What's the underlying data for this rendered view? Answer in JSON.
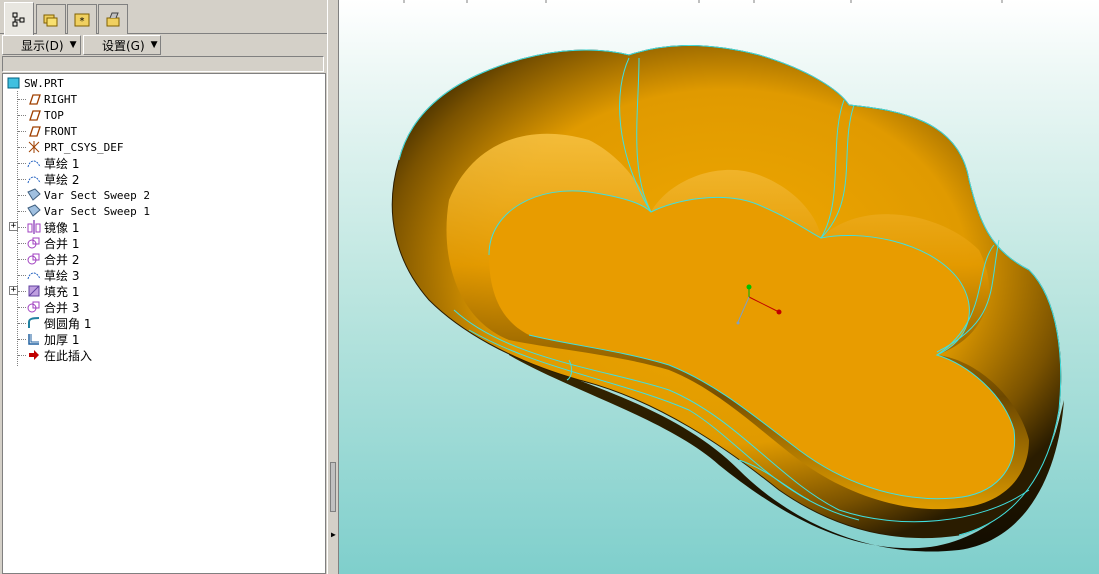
{
  "toolbar": {
    "show_label": "显示(D)",
    "settings_label": "设置(G)"
  },
  "tree": {
    "root": "SW.PRT",
    "items": [
      {
        "label": "RIGHT",
        "icon": "datum-plane-icon"
      },
      {
        "label": "TOP",
        "icon": "datum-plane-icon"
      },
      {
        "label": "FRONT",
        "icon": "datum-plane-icon"
      },
      {
        "label": "PRT_CSYS_DEF",
        "icon": "csys-icon"
      },
      {
        "label": "草绘 1",
        "icon": "sketch-icon"
      },
      {
        "label": "草绘 2",
        "icon": "sketch-icon"
      },
      {
        "label": "Var Sect Sweep 2",
        "icon": "sweep-icon"
      },
      {
        "label": "Var Sect Sweep 1",
        "icon": "sweep-icon"
      },
      {
        "label": "镜像 1",
        "icon": "mirror-icon"
      },
      {
        "label": "合并 1",
        "icon": "merge-icon"
      },
      {
        "label": "合并 2",
        "icon": "merge-icon"
      },
      {
        "label": "草绘 3",
        "icon": "sketch-icon"
      },
      {
        "label": "填充 1",
        "icon": "fill-icon"
      },
      {
        "label": "合并 3",
        "icon": "merge-icon"
      },
      {
        "label": "倒圆角 1",
        "icon": "round-icon"
      },
      {
        "label": "加厚 1",
        "icon": "thicken-icon"
      },
      {
        "label": "在此插入",
        "icon": "insert-here-icon"
      }
    ]
  },
  "colors": {
    "surface": "#e89c00",
    "edge": "#40e0e0",
    "panel": "#d4d0c8"
  }
}
